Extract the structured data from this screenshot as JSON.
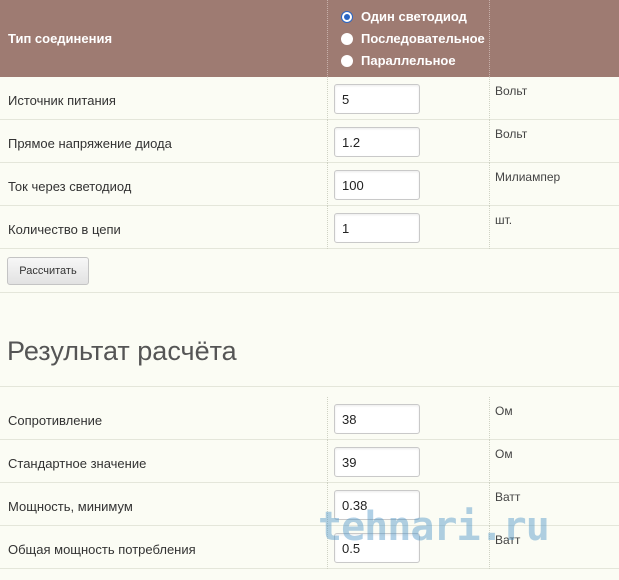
{
  "header": {
    "title": "Тип соединения",
    "options": [
      {
        "label": "Один светодиод",
        "checked": true
      },
      {
        "label": "Последовательное",
        "checked": false
      },
      {
        "label": "Параллельное",
        "checked": false
      }
    ]
  },
  "inputs": [
    {
      "label": "Источник питания",
      "value": "5",
      "unit": "Вольт"
    },
    {
      "label": "Прямое напряжение диода",
      "value": "1.2",
      "unit": "Вольт"
    },
    {
      "label": "Ток через светодиод",
      "value": "100",
      "unit": "Милиампер"
    },
    {
      "label": "Количество в цепи",
      "value": "1",
      "unit": "шт."
    }
  ],
  "calculate_button": "Рассчитать",
  "result": {
    "title": "Результат расчёта",
    "rows": [
      {
        "label": "Сопротивление",
        "value": "38",
        "unit": "Ом"
      },
      {
        "label": "Стандартное значение",
        "value": "39",
        "unit": "Ом"
      },
      {
        "label": "Мощность, минимум",
        "value": "0.38",
        "unit": "Ватт"
      },
      {
        "label": "Общая мощность потребления",
        "value": "0.5",
        "unit": "Ватт"
      }
    ]
  },
  "watermark": "tehnari.ru",
  "colors": {
    "header_bg": "#9e7b72",
    "page_bg": "#fbfcf4",
    "radio_accent": "#2a66c4"
  }
}
